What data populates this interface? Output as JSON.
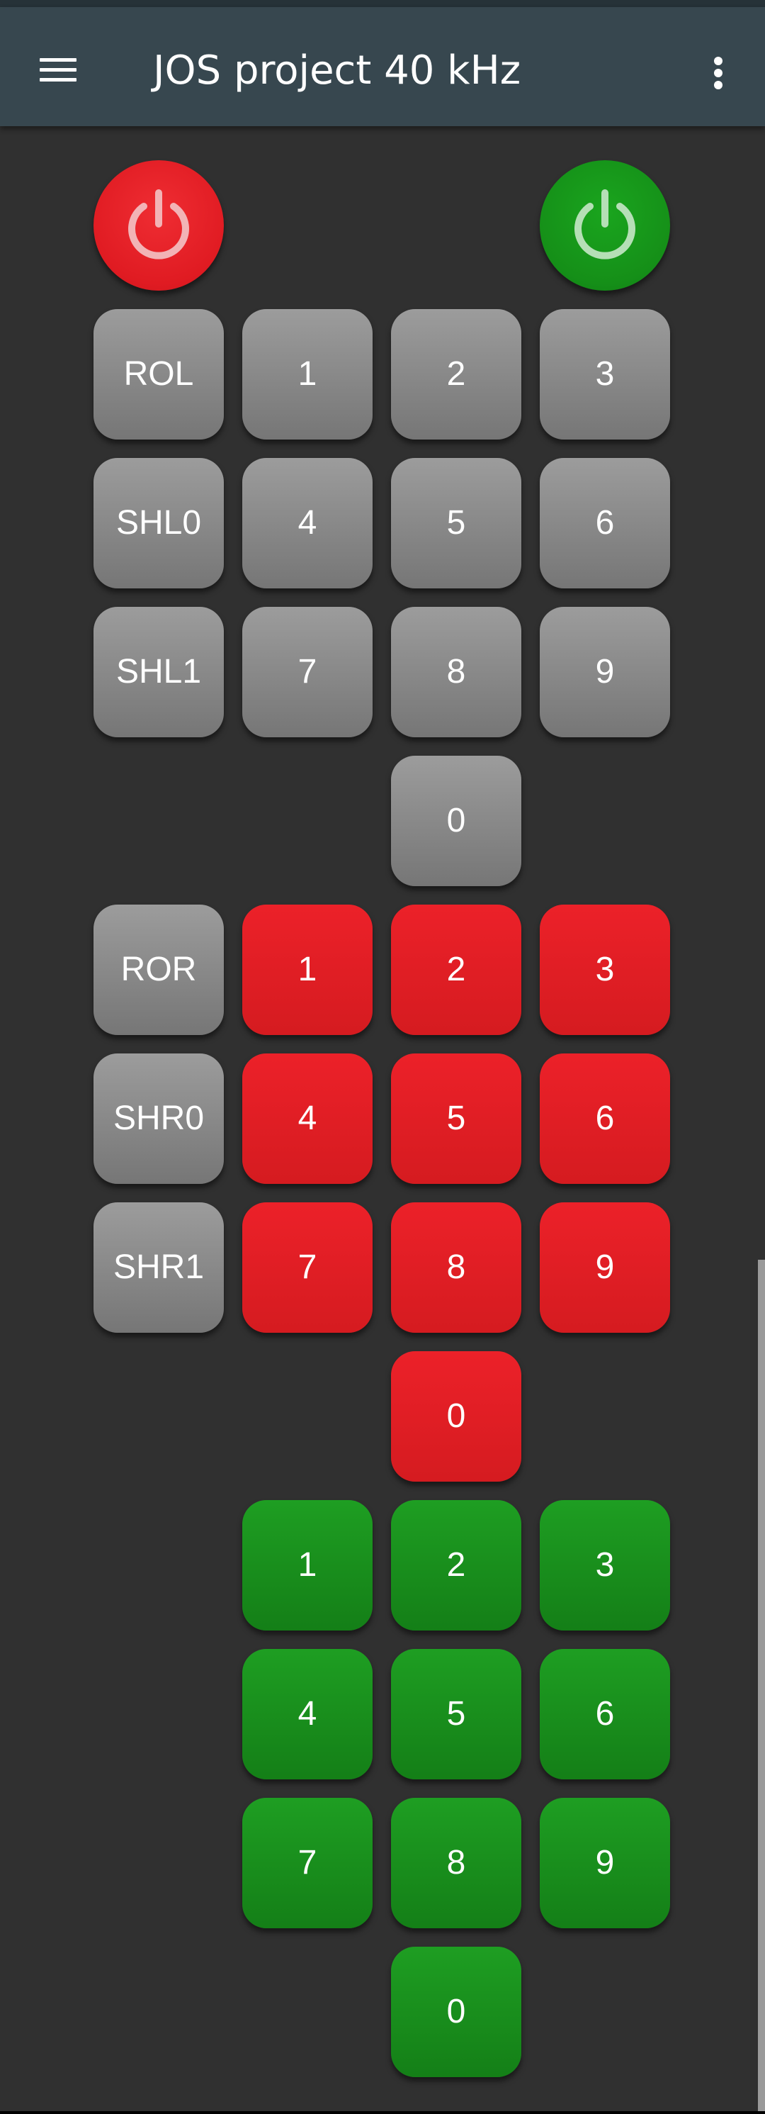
{
  "app_bar": {
    "title": "JOS project 40 kHz",
    "menu_icon": "hamburger-menu-icon",
    "overflow_icon": "more-vert-icon"
  },
  "power_buttons": {
    "off_icon": "power-icon",
    "on_icon": "power-icon",
    "off_color": "#e01b22",
    "on_color": "#158f18"
  },
  "colors": {
    "background": "#303030",
    "app_bar": "#37474f",
    "grey_key": "#888888",
    "red_key": "#e01e25",
    "green_key": "#178f1a"
  },
  "grey_section": {
    "rol_label": "ROL",
    "shl0_label": "SHL0",
    "shl1_label": "SHL1",
    "digits": [
      "1",
      "2",
      "3",
      "4",
      "5",
      "6",
      "7",
      "8",
      "9",
      "0"
    ]
  },
  "red_section": {
    "ror_label": "ROR",
    "shr0_label": "SHR0",
    "shr1_label": "SHR1",
    "digits": [
      "1",
      "2",
      "3",
      "4",
      "5",
      "6",
      "7",
      "8",
      "9",
      "0"
    ]
  },
  "green_section": {
    "digits": [
      "1",
      "2",
      "3",
      "4",
      "5",
      "6",
      "7",
      "8",
      "9",
      "0"
    ]
  }
}
